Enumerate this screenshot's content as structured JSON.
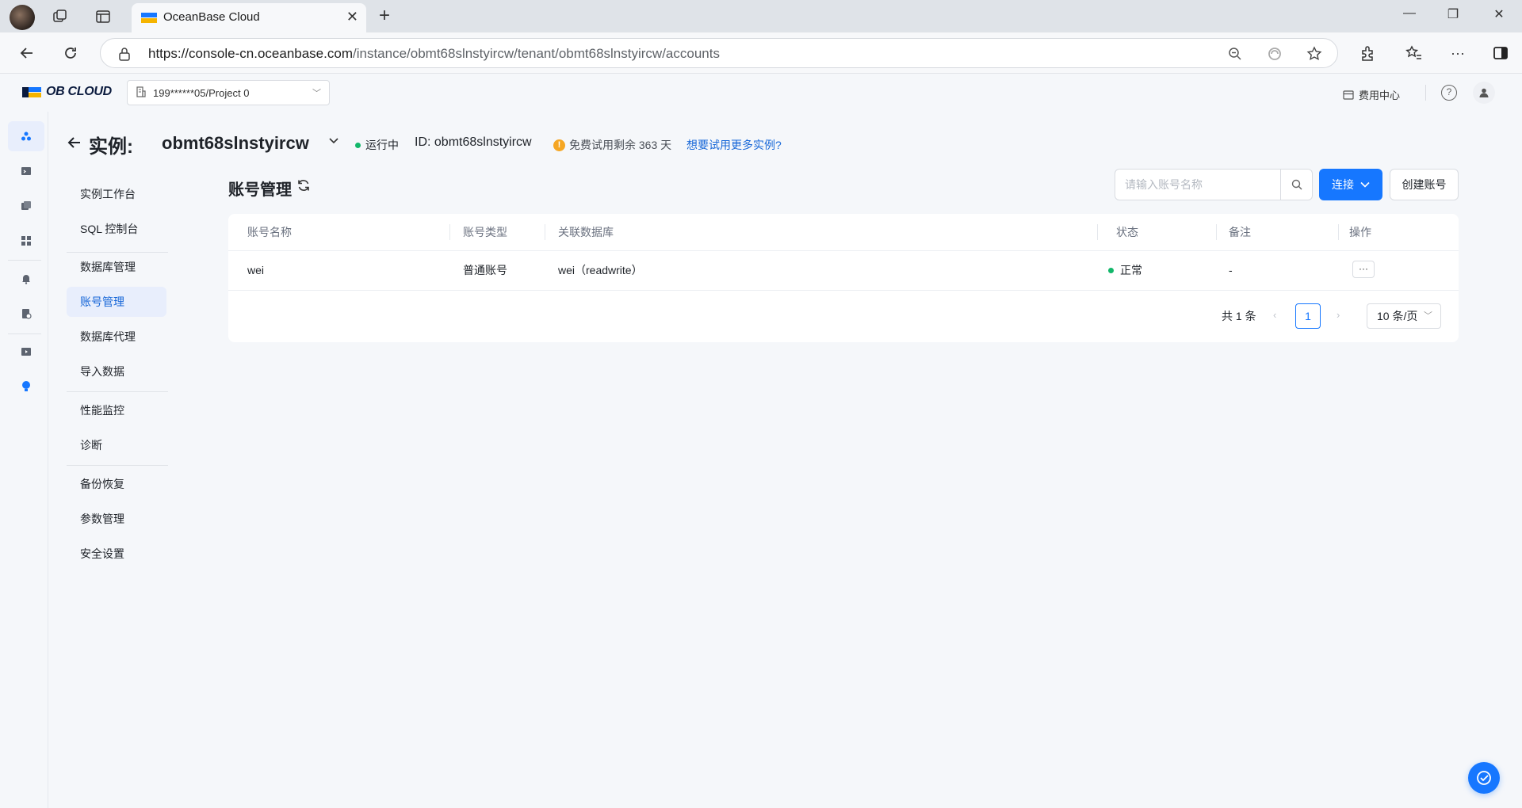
{
  "browser": {
    "tab_title": "OceanBase Cloud",
    "url_host": "https://console-cn.oceanbase.com",
    "url_path": "/instance/obmt68slnstyircw/tenant/obmt68slnstyircw/accounts"
  },
  "header": {
    "logo_text": "OB CLOUD",
    "project": "199******05/Project 0",
    "fee_center": "费用中心"
  },
  "page": {
    "title_label": "实例:",
    "instance_name": "obmt68slnstyircw",
    "status": "运行中",
    "instance_id": "ID: obmt68slnstyircw",
    "trial_text": "免费试用剩余 363 天",
    "trial_link": "想要试用更多实例?"
  },
  "subnav": {
    "items": [
      {
        "label": "实例工作台"
      },
      {
        "label": "SQL 控制台"
      },
      {
        "label": "数据库管理"
      },
      {
        "label": "账号管理"
      },
      {
        "label": "数据库代理"
      },
      {
        "label": "导入数据"
      },
      {
        "label": "性能监控"
      },
      {
        "label": "诊断"
      },
      {
        "label": "备份恢复"
      },
      {
        "label": "参数管理"
      },
      {
        "label": "安全设置"
      }
    ],
    "active_index": 3
  },
  "main": {
    "section_title": "账号管理",
    "search_placeholder": "请输入账号名称",
    "connect_label": "连接",
    "create_label": "创建账号"
  },
  "table": {
    "columns": [
      "账号名称",
      "账号类型",
      "关联数据库",
      "状态",
      "备注",
      "操作"
    ],
    "rows": [
      {
        "name": "wei",
        "type": "普通账号",
        "db": "wei（readwrite）",
        "status": "正常",
        "note": "-",
        "action": "···"
      }
    ]
  },
  "pagination": {
    "total": "共 1 条",
    "current_page": "1",
    "page_size": "10 条/页"
  },
  "colors": {
    "accent": "#1677ff",
    "status_ok": "#12b76a",
    "warning": "#f5a623"
  }
}
